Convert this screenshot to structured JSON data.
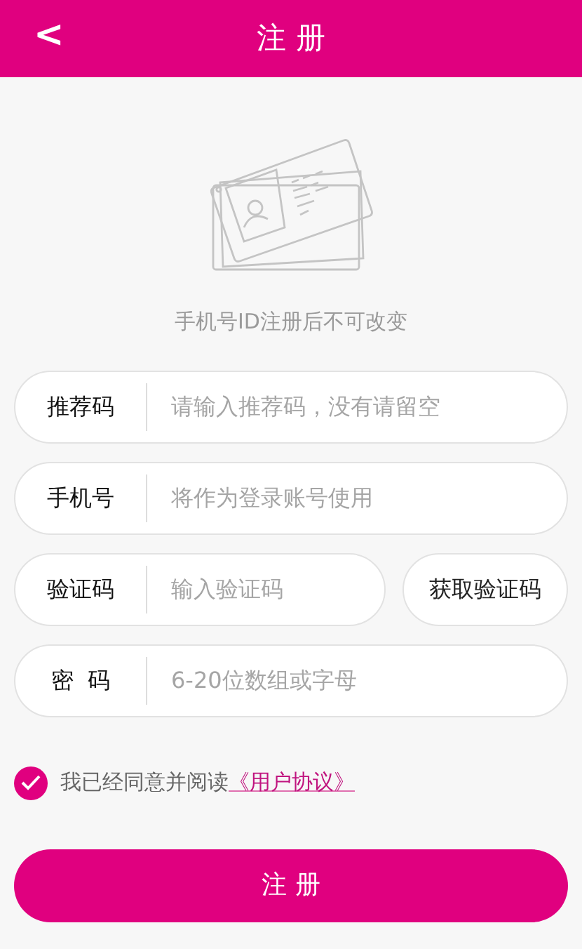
{
  "header": {
    "back": "<",
    "title": "注 册"
  },
  "hint": "手机号ID注册后不可改变",
  "fields": [
    {
      "label": "推荐码",
      "placeholder": "请输入推荐码，没有请留空"
    },
    {
      "label": "手机号",
      "placeholder": "将作为登录账号使用"
    },
    {
      "label": "验证码",
      "placeholder": "输入验证码",
      "button": "获取验证码"
    },
    {
      "label": "密  码",
      "placeholder": "6-20位数组或字母"
    }
  ],
  "agreement": {
    "checked": true,
    "text": "我已经同意并阅读",
    "link": "《用户协议》"
  },
  "submit": "注 册"
}
